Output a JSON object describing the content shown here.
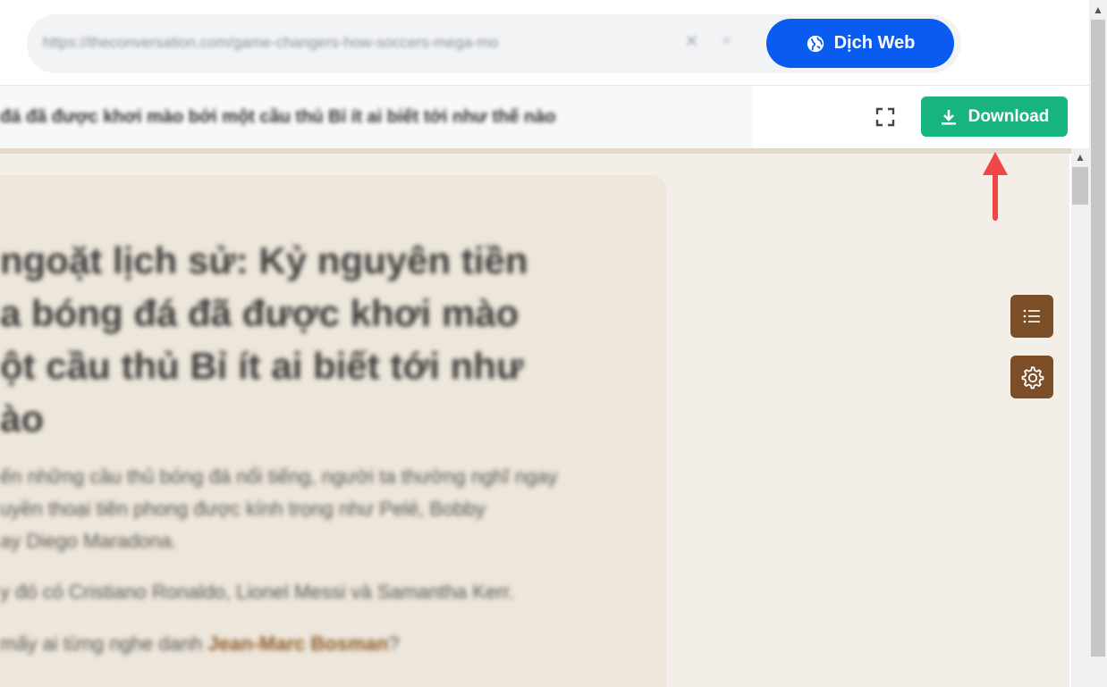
{
  "toolbar": {
    "url": "https://theconversation.com/game-changers-how-soccers-mega-mo",
    "clear_icon": "x-icon",
    "search_icon": "magnifier-icon",
    "translate_label": "Dịch Web",
    "translate_icon": "globe-icon"
  },
  "reader": {
    "title": "đá đã được khơi mào bởi một cầu thủ Bỉ ít ai biết tới như thế nào",
    "expand_icon": "fullscreen-icon",
    "download_label": "Download",
    "download_icon": "download-icon"
  },
  "article": {
    "headline": "ngoặt lịch sử: Kỷ nguyên tiền\na bóng đá đã được khơi mào\nột cầu thủ Bỉ ít ai biết tới như\nào",
    "para1_line1": "ến những cầu thủ bóng đá nổi tiếng, người ta thường nghĩ ngay",
    "para1_line2": "uyền thoại tiên phong được kính trọng như Pelé, Bobby",
    "para1_line3": "ay Diego Maradona.",
    "para2": "y đó có Cristiano Ronaldo, Lionel Messi và Samantha Kerr.",
    "para3_before": "mấy ai từng nghe danh ",
    "para3_link": "Jean-Marc Bosman",
    "para3_after": "?"
  },
  "side_buttons": {
    "toc_icon": "list-icon",
    "settings_icon": "gear-icon"
  },
  "colors": {
    "translate_bg": "#0a5cf0",
    "download_bg": "#18b47e",
    "side_button_bg": "#7b4e27",
    "arrow": "#f04646"
  }
}
